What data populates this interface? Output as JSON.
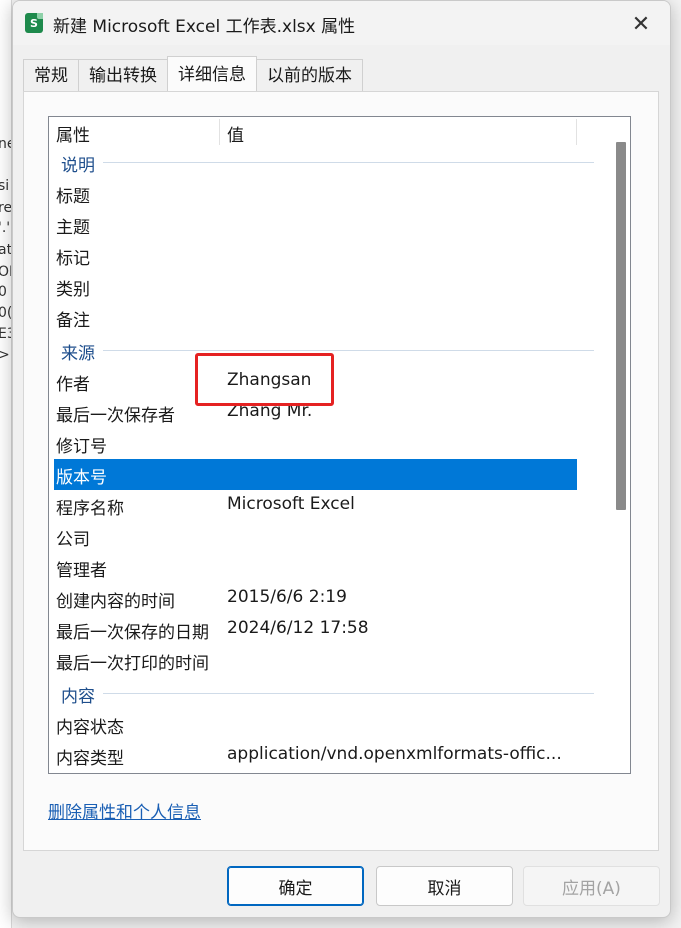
{
  "background_fragments": [
    "ne",
    "si",
    "re",
    "'.'",
    "at",
    "OL",
    "0",
    "0(",
    "E3",
    ">"
  ],
  "window": {
    "title": "新建 Microsoft Excel 工作表.xlsx 属性",
    "app_icon_glyph": "S",
    "close_glyph": "✕"
  },
  "tabs": [
    {
      "label": "常规",
      "active": false
    },
    {
      "label": "输出转换",
      "active": false
    },
    {
      "label": "详细信息",
      "active": true
    },
    {
      "label": "以前的版本",
      "active": false
    }
  ],
  "list": {
    "column_property": "属性",
    "column_value": "值",
    "groups": {
      "description": "说明",
      "origin": "来源",
      "content": "内容"
    },
    "rows": [
      {
        "name": "标题",
        "value": ""
      },
      {
        "name": "主题",
        "value": ""
      },
      {
        "name": "标记",
        "value": ""
      },
      {
        "name": "类别",
        "value": ""
      },
      {
        "name": "备注",
        "value": ""
      },
      {
        "name": "作者",
        "value": "Zhangsan"
      },
      {
        "name": "最后一次保存者",
        "value": "Zhang Mr."
      },
      {
        "name": "修订号",
        "value": ""
      },
      {
        "name": "版本号",
        "value": ""
      },
      {
        "name": "程序名称",
        "value": "Microsoft Excel"
      },
      {
        "name": "公司",
        "value": ""
      },
      {
        "name": "管理者",
        "value": ""
      },
      {
        "name": "创建内容的时间",
        "value": "2015/6/6 2:19"
      },
      {
        "name": "最后一次保存的日期",
        "value": "2024/6/12 17:58"
      },
      {
        "name": "最后一次打印的时间",
        "value": ""
      },
      {
        "name": "内容状态",
        "value": ""
      },
      {
        "name": "内容类型",
        "value": "application/vnd.openxmlformats-offic..."
      }
    ],
    "selected_row": "版本号"
  },
  "delete_link": "删除属性和个人信息",
  "buttons": {
    "ok": "确定",
    "cancel": "取消",
    "apply": "应用(A)"
  },
  "colors": {
    "selection": "#0078d7",
    "highlight_box": "#e52222",
    "group_text": "#1e4e8c",
    "link": "#1a5fb4"
  }
}
